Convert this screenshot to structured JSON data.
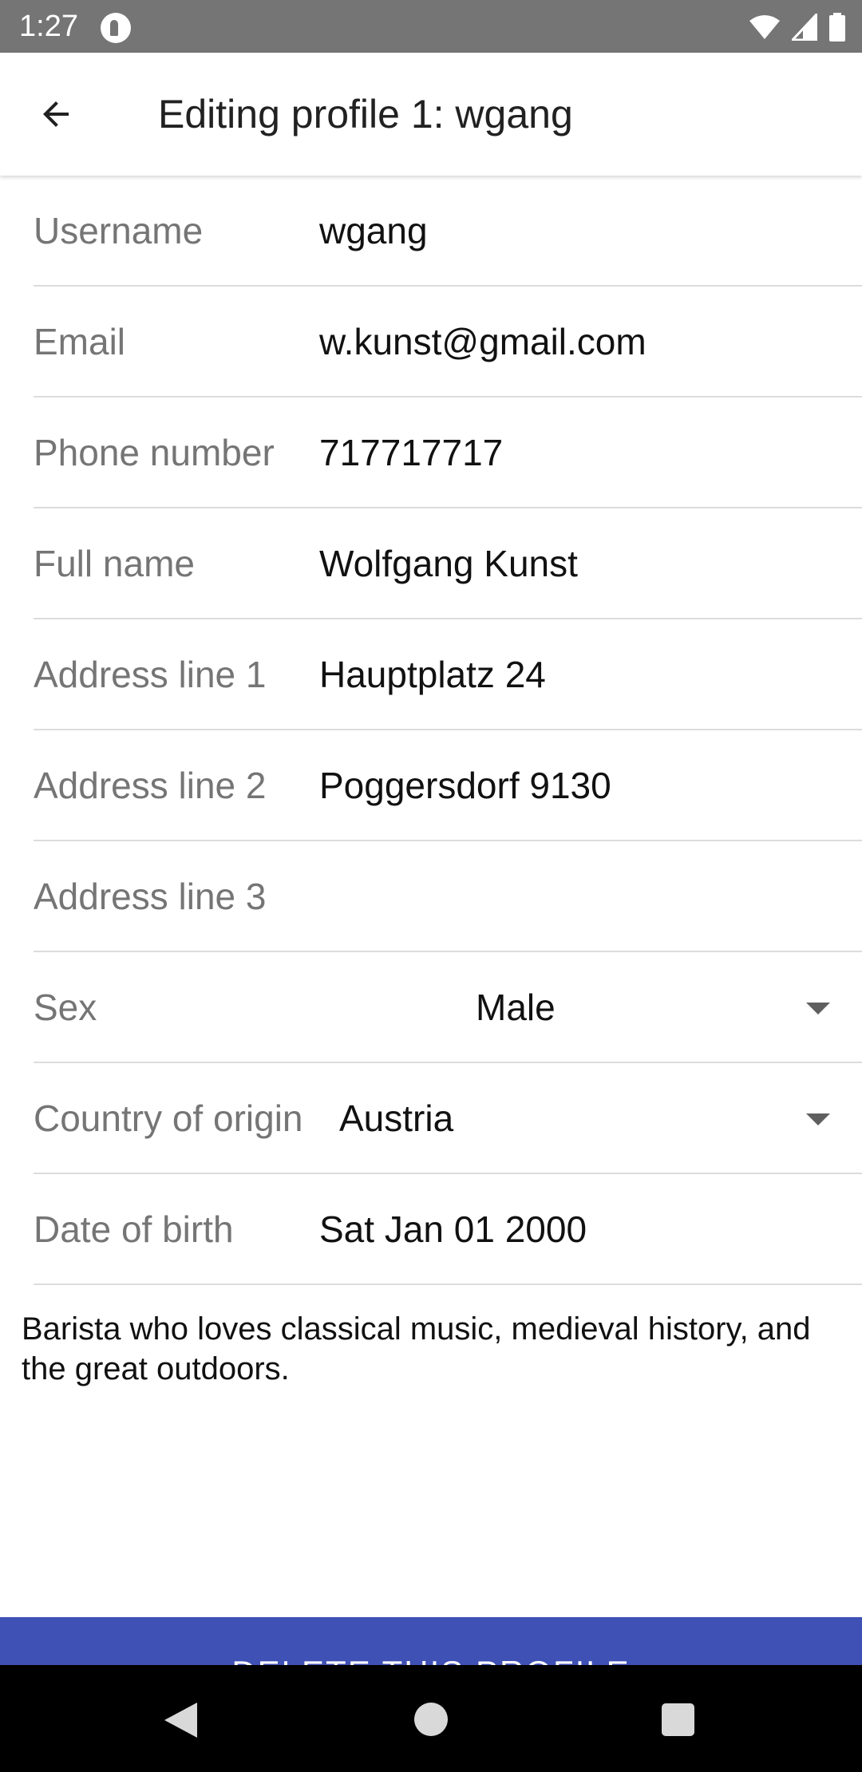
{
  "status_bar": {
    "time": "1:27",
    "icons": [
      "app-notification-icon",
      "wifi-icon",
      "cell-signal-icon",
      "battery-icon"
    ]
  },
  "app_bar": {
    "title": "Editing profile 1: wgang",
    "back_icon": "arrow-back-icon"
  },
  "form": {
    "username": {
      "label": "Username",
      "value": "wgang"
    },
    "email": {
      "label": "Email",
      "value": "w.kunst@gmail.com"
    },
    "phone": {
      "label": "Phone number",
      "value": "717717717"
    },
    "full_name": {
      "label": "Full name",
      "value": "Wolfgang Kunst"
    },
    "address1": {
      "label": "Address line 1",
      "value": "Hauptplatz 24"
    },
    "address2": {
      "label": "Address line 2",
      "value": "Poggersdorf 9130"
    },
    "address3": {
      "label": "Address line 3",
      "value": ""
    },
    "sex": {
      "label": "Sex",
      "value": "Male"
    },
    "country": {
      "label": "Country of origin",
      "value": "Austria"
    },
    "dob": {
      "label": "Date of birth",
      "value": "Sat Jan 01 2000"
    }
  },
  "bio": "Barista who loves classical music, medieval history, and the great outdoors.",
  "delete_button": {
    "label": "DELETE THIS PROFILE"
  },
  "colors": {
    "status_bar": "#757575",
    "accent": "#3f51b5",
    "label_text": "#757575",
    "divider": "#dcdcdc"
  }
}
